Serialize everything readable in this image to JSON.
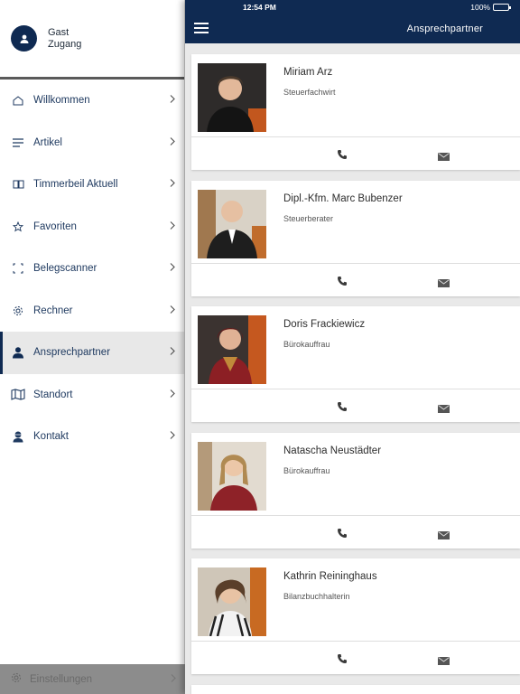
{
  "status": {
    "time": "12:54 PM",
    "battery": "100%",
    "battery_level": 1.0
  },
  "sidebar": {
    "user": {
      "line1": "Gast",
      "line2": "Zugang"
    },
    "items": [
      {
        "label": "Willkommen",
        "icon": "home-icon"
      },
      {
        "label": "Artikel",
        "icon": "list-icon"
      },
      {
        "label": "Timmerbeil Aktuell",
        "icon": "book-icon"
      },
      {
        "label": "Favoriten",
        "icon": "star-icon"
      },
      {
        "label": "Belegscanner",
        "icon": "scan-icon"
      },
      {
        "label": "Rechner",
        "icon": "gear-icon"
      },
      {
        "label": "Ansprechpartner",
        "icon": "person-icon"
      },
      {
        "label": "Standort",
        "icon": "map-icon"
      },
      {
        "label": "Kontakt",
        "icon": "contact-icon"
      }
    ],
    "active_index": 6,
    "settings_label": "Einstellungen"
  },
  "header": {
    "title": "Ansprechpartner",
    "color": "#0f2a52"
  },
  "contacts": [
    {
      "name": "Miriam Arz",
      "role": "Steuerfachwirt",
      "photo_bg": "#5c4a3a"
    },
    {
      "name": "Dipl.-Kfm. Marc Bubenzer",
      "role": "Steuerberater",
      "photo_bg": "#8a6a4a"
    },
    {
      "name": "Doris Frackiewicz",
      "role": "Bürokauffrau",
      "photo_bg": "#6d4b3a"
    },
    {
      "name": "Natascha Neustädter",
      "role": "Bürokauffrau",
      "photo_bg": "#b9a994"
    },
    {
      "name": "Kathrin Reininghaus",
      "role": "Bilanzbuchhalterin",
      "photo_bg": "#7a5a3e"
    }
  ]
}
